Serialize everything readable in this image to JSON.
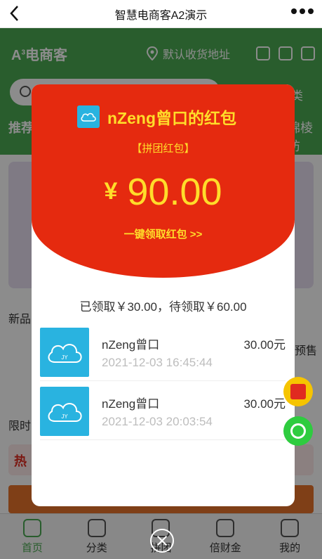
{
  "titlebar": {
    "title": "智慧电商客A2演示"
  },
  "header": {
    "logo": "电商客",
    "logo_sup": "3",
    "address": "默认收货地址",
    "category_link": "分类",
    "tabs": [
      "推荐",
      "锦棱纺"
    ]
  },
  "content": {
    "side_left_1": "新品",
    "side_right_1": "预售",
    "side_left_2": "限时",
    "hot_label": "热"
  },
  "modal": {
    "title": "nZeng曾口的红包",
    "subtitle": "【拼团红包】",
    "currency": "¥",
    "amount": "90.00",
    "claim_link": "一键领取红包 >>",
    "summary": "已领取￥30.00，待领取￥60.00",
    "records": [
      {
        "avatar_text": "JY",
        "name": "nZeng曾口",
        "amount": "30.00元",
        "time": "2021-12-03 16:45:44"
      },
      {
        "avatar_text": "JY",
        "name": "nZeng曾口",
        "amount": "30.00元",
        "time": "2021-12-03 20:03:54"
      }
    ]
  },
  "tabbar": {
    "items": [
      {
        "label": "首页",
        "icon": "home-icon"
      },
      {
        "label": "分类",
        "icon": "category-icon"
      },
      {
        "label": "拼团",
        "icon": "compass-icon"
      },
      {
        "label": "倍财金",
        "icon": "wallet-icon"
      },
      {
        "label": "我的",
        "icon": "user-icon"
      }
    ]
  },
  "colors": {
    "brand_green": "#4caa53",
    "packet_red": "#e52a0f",
    "packet_gold": "#ffdd2a",
    "avatar_blue": "#29b3e0"
  }
}
